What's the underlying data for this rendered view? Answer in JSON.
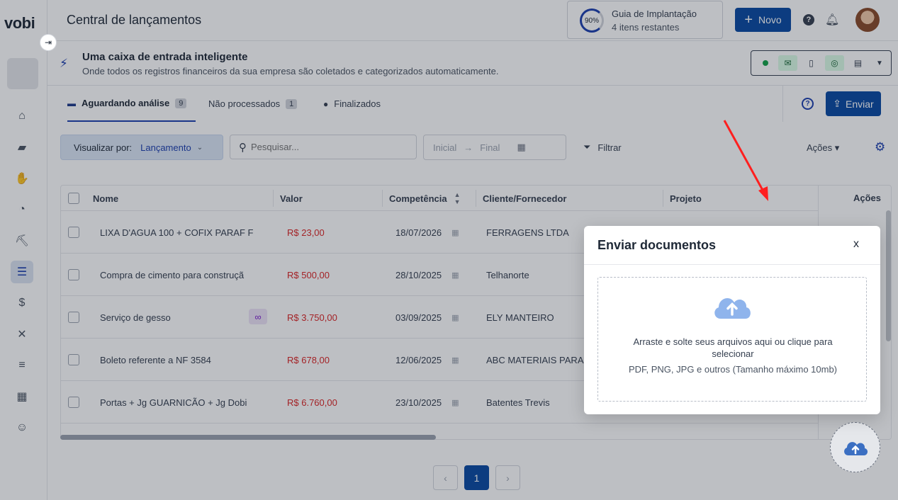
{
  "app": {
    "logo": "vobi",
    "collapse_glyph": "⇥"
  },
  "header": {
    "title": "Central de lançamentos",
    "guide": {
      "percent": "90%",
      "title": "Guia de Implantação",
      "subtitle": "4 itens restantes"
    },
    "new_button": "Novo"
  },
  "banner": {
    "title": "Uma caixa de entrada inteligente",
    "subtitle": "Onde todos os registros financeiros da sua empresa são coletados e categorizados automaticamente."
  },
  "tabs": [
    {
      "label": "Aguardando análise",
      "count": "9",
      "active": true
    },
    {
      "label": "Não processados",
      "count": "1",
      "active": false
    },
    {
      "label": "Finalizados",
      "count": "",
      "active": false
    }
  ],
  "toolbar": {
    "upload_button": "Enviar",
    "view_by_label": "Visualizar por:",
    "view_by_value": "Lançamento",
    "search_placeholder": "Pesquisar...",
    "date_start": "Inicial",
    "date_end": "Final",
    "filter_label": "Filtrar",
    "actions_label": "Ações"
  },
  "table": {
    "columns": [
      "Nome",
      "Valor",
      "Competência",
      "Cliente/Fornecedor",
      "Projeto",
      "Ações"
    ],
    "rows": [
      {
        "name": "LIXA D'AGUA 100 + COFIX PARAF F",
        "value": "R$ 23,00",
        "date": "18/07/2026",
        "client": "FERRAGENS LTDA"
      },
      {
        "name": "Compra de cimento para construçã",
        "value": "R$ 500,00",
        "date": "28/10/2025",
        "client": "Telhanorte"
      },
      {
        "name": "Serviço de gesso",
        "value": "R$ 3.750,00",
        "date": "03/09/2025",
        "client": "ELY MANTEIRO"
      },
      {
        "name": "Boleto referente a NF 3584",
        "value": "R$ 678,00",
        "date": "12/06/2025",
        "client": "ABC MATERIAIS PARA"
      },
      {
        "name": "Portas + Jg GUARNICÃO + Jg Dobi",
        "value": "R$ 6.760,00",
        "date": "23/10/2025",
        "client": "Batentes Trevis"
      }
    ]
  },
  "pagination": {
    "current": "1",
    "prev": "‹",
    "next": "›"
  },
  "modal": {
    "title": "Enviar documentos",
    "close": "x",
    "drop_text": "Arraste e solte seus arquivos aqui ou clique para selecionar",
    "hint": "PDF, PNG, JPG e outros (Tamanho máximo 10mb)"
  },
  "colors": {
    "primary": "#0b4aa2",
    "danger": "#dc2626",
    "annotation": "#ff1f1f"
  },
  "icons": {
    "sidebar": [
      "home-icon",
      "folder-icon",
      "handshake-icon",
      "gauge-icon",
      "worker-icon",
      "database-icon",
      "dollar-icon",
      "tools-icon",
      "list-icon",
      "grid-plus-icon",
      "team-icon"
    ]
  }
}
